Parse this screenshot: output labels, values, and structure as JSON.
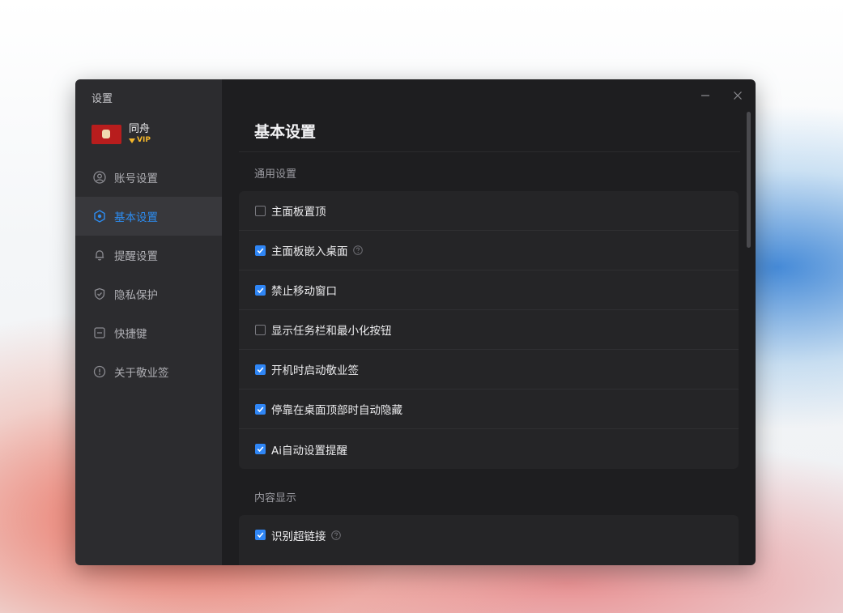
{
  "window": {
    "title": "设置",
    "controls": {
      "minimize_icon": "minimize-icon",
      "close_icon": "close-icon"
    }
  },
  "profile": {
    "name": "同舟",
    "badge": "VIP"
  },
  "sidebar": {
    "items": [
      {
        "label": "账号设置",
        "icon": "user-icon",
        "active": false
      },
      {
        "label": "基本设置",
        "icon": "settings-icon",
        "active": true
      },
      {
        "label": "提醒设置",
        "icon": "bell-icon",
        "active": false
      },
      {
        "label": "隐私保护",
        "icon": "shield-icon",
        "active": false
      },
      {
        "label": "快捷键",
        "icon": "keyboard-icon",
        "active": false
      },
      {
        "label": "关于敬业签",
        "icon": "info-icon",
        "active": false
      }
    ]
  },
  "main": {
    "title": "基本设置",
    "sections": [
      {
        "title": "通用设置",
        "options": [
          {
            "label": "主面板置顶",
            "checked": false,
            "help": false
          },
          {
            "label": "主面板嵌入桌面",
            "checked": true,
            "help": true
          },
          {
            "label": "禁止移动窗口",
            "checked": true,
            "help": false
          },
          {
            "label": "显示任务栏和最小化按钮",
            "checked": false,
            "help": false
          },
          {
            "label": "开机时启动敬业签",
            "checked": true,
            "help": false
          },
          {
            "label": "停靠在桌面顶部时自动隐藏",
            "checked": true,
            "help": false
          },
          {
            "label": "Ai自动设置提醒",
            "checked": true,
            "help": false
          }
        ]
      },
      {
        "title": "内容显示",
        "options": [
          {
            "label": "识别超链接",
            "checked": true,
            "help": true
          }
        ]
      }
    ]
  },
  "colors": {
    "accent": "#2f86f6",
    "vip": "#f3b62b",
    "sidebar_bg": "#2c2c2f",
    "main_bg": "#1e1e20",
    "card_bg": "#252527"
  }
}
